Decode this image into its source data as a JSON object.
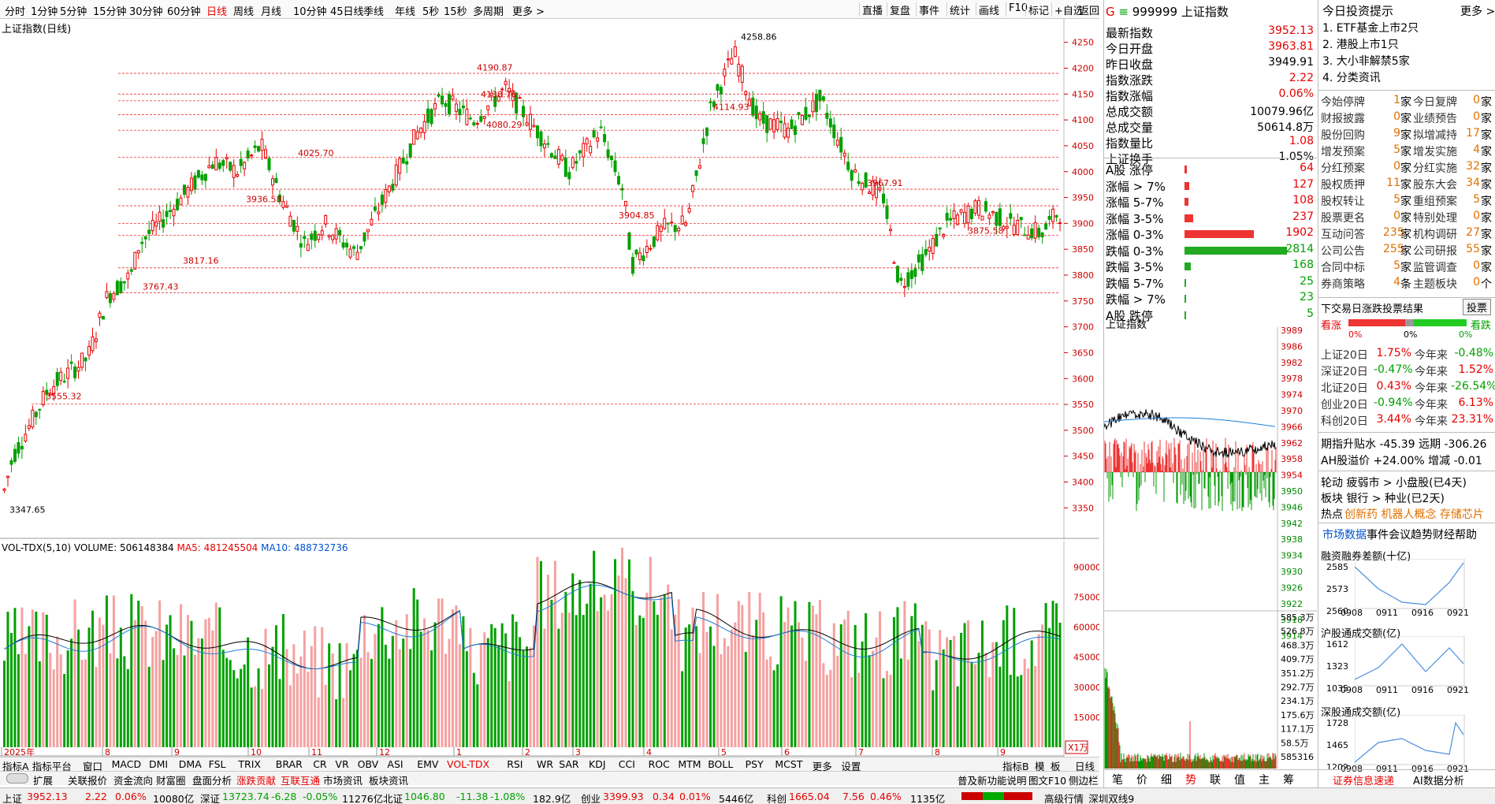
{
  "toolbar": {
    "items": [
      "分时",
      "1分钟",
      "5分钟",
      "15分钟",
      "30分钟",
      "60分钟",
      "日线",
      "周线",
      "月线",
      "10分钟",
      "45日线",
      "季线",
      "年线",
      "5秒",
      "15秒",
      "多周期",
      "更多 >"
    ],
    "selected": "日线",
    "right": [
      "直播",
      "复盘",
      "事件",
      "统计",
      "画线",
      "F10",
      "标记",
      "+自选",
      "返回"
    ]
  },
  "chart": {
    "title": "上证指数(日线)",
    "y_ticks": [
      "4250",
      "4200",
      "4150",
      "4100",
      "4050",
      "4000",
      "3950",
      "3900",
      "3850",
      "3800",
      "3750",
      "3700",
      "3650",
      "3600",
      "3550",
      "3500",
      "3450",
      "3400",
      "3350"
    ],
    "annotations": [
      "4258.86",
      "4190.87",
      "4138.76",
      "4080.29",
      "4025.70",
      "3936.58",
      "3817.16",
      "3767.43",
      "3555.32",
      "3347.65",
      "4114.93",
      "3967.91",
      "3904.85",
      "3875.58"
    ],
    "x_ticks": [
      "2025年",
      "8",
      "9",
      "10",
      "11",
      "12",
      "1",
      "2",
      "3",
      "4",
      "5",
      "6",
      "7",
      "8",
      "9"
    ]
  },
  "volume": {
    "title": "VOL-TDX(5,10)",
    "volume_label": "VOLUME: 506148384",
    "ma5_label": "MA5: 481245504",
    "ma10_label": "MA10: 488732736",
    "y_ticks": [
      "90000",
      "75000",
      "60000",
      "45000",
      "30000",
      "15000"
    ],
    "unit": "X1万"
  },
  "chart_data": {
    "type": "candlestick",
    "title": "上证指数(日线)",
    "ylim": [
      3320,
      4280
    ],
    "points": [
      {
        "label": "high",
        "value": 4258.86
      },
      {
        "label": "peak",
        "value": 4190.87
      },
      {
        "label": "low",
        "value": 3347.65
      }
    ],
    "volume": {
      "ylim": [
        0,
        100000
      ]
    }
  },
  "indicator_tabs": [
    "指标A",
    "指标平台",
    "窗口",
    "MACD",
    "DMI",
    "DMA",
    "FSL",
    "TRIX",
    "BRAR",
    "CR",
    "VR",
    "OBV",
    "ASI",
    "EMV",
    "VOL-TDX",
    "RSI",
    "WR",
    "SAR",
    "KDJ",
    "CCI",
    "ROC",
    "MTM",
    "BOLL",
    "PSY",
    "MCST",
    "更多",
    "设置"
  ],
  "indicator_active": "VOL-TDX",
  "bottom_right": [
    "指标B",
    "模",
    "板",
    "日线"
  ],
  "tabs2": [
    "扩展",
    "关联报价",
    "资金流向",
    "财富圈",
    "盘面分析",
    "涨跌贡献",
    "互联互通",
    "市场资讯",
    "板块资讯"
  ],
  "tabs2_right": [
    "普及新功能说明",
    "图文F10",
    "侧边栏"
  ],
  "status": {
    "sh": "上证",
    "sh_val": "3952.13",
    "sh_chg": "2.22",
    "sh_pct": "0.06%",
    "sh_amt": "10080亿",
    "sz": "深证",
    "sz_val": "13723.74",
    "sz_chg": "-6.28",
    "sz_pct": "-0.05%",
    "sz_amt": "11276亿",
    "bz": "北证",
    "bz_val": "1046.80",
    "bz_chg": "-11.38",
    "bz_pct": "-1.08%",
    "bz_amt": "182.9亿",
    "cy": "创业",
    "cy_val": "3399.93",
    "cy_chg": "0.34",
    "cy_pct": "0.01%",
    "cy_amt": "5446亿",
    "kc": "科创",
    "kc_val": "1665.04",
    "kc_chg": "7.56",
    "kc_pct": "0.46%",
    "kc_amt": "1135亿",
    "market": "高级行情_深圳双线9"
  },
  "quote": {
    "code": "999999",
    "name": "上证指数",
    "rows": [
      [
        "最新指数",
        "3952.13"
      ],
      [
        "今日开盘",
        "3963.81"
      ],
      [
        "昨日收盘",
        "3949.91"
      ],
      [
        "指数涨跌",
        "2.22"
      ],
      [
        "指数涨幅",
        "0.06%"
      ],
      [
        "总成交额",
        "10079.96亿"
      ],
      [
        "总成交量",
        "50614.8万"
      ],
      [
        "指数量比",
        "1.08"
      ],
      [
        "上证换手",
        "1.05%"
      ]
    ],
    "dist": [
      [
        "A股 涨停",
        "64"
      ],
      [
        "涨幅 > 7%",
        "127"
      ],
      [
        "涨幅 5-7%",
        "108"
      ],
      [
        "涨幅 3-5%",
        "237"
      ],
      [
        "涨幅 0-3%",
        "1902"
      ],
      [
        "跌幅 0-3%",
        "2814"
      ],
      [
        "跌幅 3-5%",
        "168"
      ],
      [
        "跌幅 5-7%",
        "25"
      ],
      [
        "跌幅 > 7%",
        "23"
      ],
      [
        "A股 跌停",
        "5"
      ]
    ]
  },
  "mini": {
    "title": "上证指数",
    "y_right": [
      "3989",
      "3986",
      "3982",
      "3978",
      "3974",
      "3970",
      "3966",
      "3962",
      "3958",
      "3954",
      "3950",
      "3946",
      "3942",
      "3938",
      "3934",
      "3930",
      "3926",
      "3922",
      "3918",
      "3914"
    ],
    "vol_right": [
      "585.3万",
      "526.8万",
      "468.3万",
      "409.7万",
      "351.2万",
      "292.7万",
      "234.1万",
      "175.6万",
      "117.1万",
      "58.5万",
      "585316"
    ],
    "tabs": [
      "笔",
      "价",
      "细",
      "势",
      "联",
      "值",
      "主",
      "筹"
    ]
  },
  "tips": {
    "title": "今日投资提示",
    "more": "更多 >",
    "items": [
      "1. ETF基金上市2只",
      "2. 港股上市1只",
      "3. 大小非解禁5家",
      "4. 分类资讯"
    ],
    "grid": [
      [
        "今始停牌",
        "1",
        "家",
        "今日复牌",
        "0",
        "家"
      ],
      [
        "财报披露",
        "0",
        "家",
        "业绩预告",
        "0",
        "家"
      ],
      [
        "股份回购",
        "9",
        "家",
        "拟增减持",
        "17",
        "家"
      ],
      [
        "增发预案",
        "5",
        "家",
        "增发实施",
        "4",
        "家"
      ],
      [
        "分红预案",
        "0",
        "家",
        "分红实施",
        "32",
        "家"
      ],
      [
        "股权质押",
        "11",
        "家",
        "股东大会",
        "34",
        "家"
      ],
      [
        "股权转让",
        "5",
        "家",
        "重组预案",
        "5",
        "家"
      ],
      [
        "股票更名",
        "0",
        "家",
        "特别处理",
        "0",
        "家"
      ],
      [
        "互动问答",
        "235",
        "家",
        "机构调研",
        "27",
        "家"
      ],
      [
        "公司公告",
        "255",
        "家",
        "公司研报",
        "55",
        "家"
      ],
      [
        "合同中标",
        "5",
        "家",
        "监管调查",
        "0",
        "家"
      ],
      [
        "券商策略",
        "4",
        "条",
        "主题板块",
        "0",
        "个"
      ]
    ],
    "vote_title": "下交易日涨跌投票结果",
    "vote_btn": "投票",
    "bull": "看涨",
    "bear": "看跌",
    "pcts": [
      "0%",
      "0%",
      "0%"
    ],
    "perf": [
      [
        "上证20日",
        "1.75%",
        "今年来",
        "-0.48%"
      ],
      [
        "深证20日",
        "-0.47%",
        "今年来",
        "1.52%"
      ],
      [
        "北证20日",
        "0.43%",
        "今年来",
        "-26.54%"
      ],
      [
        "创业20日",
        "-0.94%",
        "今年来",
        "6.13%"
      ],
      [
        "科创20日",
        "3.44%",
        "今年来",
        "23.31%"
      ]
    ],
    "spread1": "期指升贴水 -45.39 远期 -306.26",
    "spread2": "AH股溢价 +24.00% 增减 -0.01",
    "rotate": "轮动 疲弱市 > 小盘股(已4天)",
    "board": "板块 银行 > 种业(已2天)",
    "hot_label": "热点",
    "hot": "创新药 机器人概念 存储芯片",
    "data_tabs": [
      "市场数据",
      "事件会议",
      "趋势财经",
      "帮助"
    ],
    "margin": "融资融券差额(十亿)",
    "margin_y": [
      "2585",
      "2573",
      "2560"
    ],
    "sh_conn": "沪股通成交额(亿)",
    "sh_y": [
      "1612",
      "1323",
      "1035"
    ],
    "sz_conn": "深股通成交额(亿)",
    "sz_y": [
      "1728",
      "1465",
      "1202"
    ],
    "dates": [
      "0908",
      "0911",
      "0916",
      "0921"
    ],
    "footer": [
      "证券信息速递",
      "AI数据分析"
    ]
  }
}
